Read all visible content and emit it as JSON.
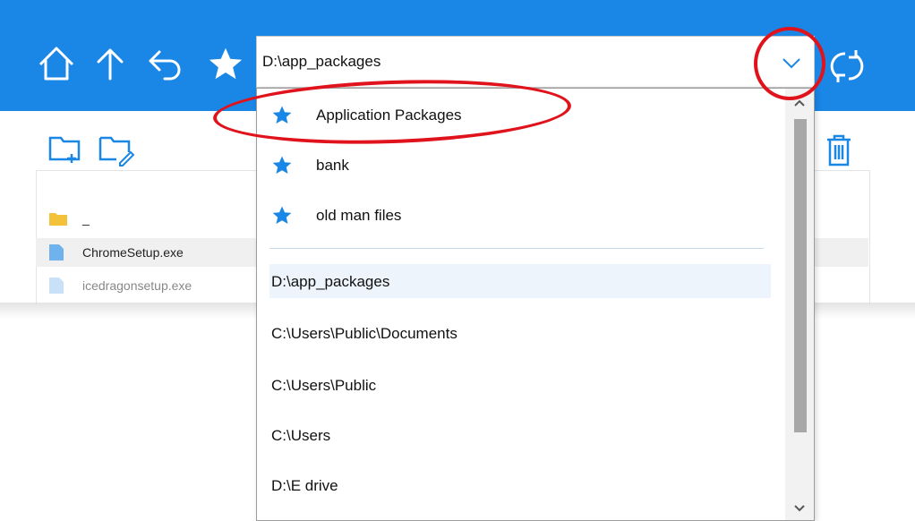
{
  "toolbar": {
    "address_value": "D:\\app_packages",
    "icons": [
      "home-icon",
      "up-arrow-icon",
      "back-icon",
      "favorites-star-icon",
      "chevron-down-icon",
      "refresh-icon"
    ]
  },
  "actions": {
    "icons": [
      "new-folder-icon",
      "rename-folder-icon",
      "delete-icon"
    ]
  },
  "files": [
    {
      "name": "_",
      "type": "folder"
    },
    {
      "name": "ChromeSetup.exe",
      "type": "file"
    },
    {
      "name": "icedragonsetup.exe",
      "type": "file"
    }
  ],
  "dropdown": {
    "favorites": [
      "Application Packages",
      "bank",
      "old man files"
    ],
    "recent": [
      "D:\\app_packages",
      "C:\\Users\\Public\\Documents",
      "C:\\Users\\Public",
      "C:\\Users",
      "D:\\E drive"
    ]
  },
  "colors": {
    "toolbar_blue": "#1a86e6",
    "star_blue": "#1a86e6",
    "highlight_red": "#e0131c",
    "folder_yellow": "#f3c23a",
    "file_blue": "#6fb3ee"
  }
}
